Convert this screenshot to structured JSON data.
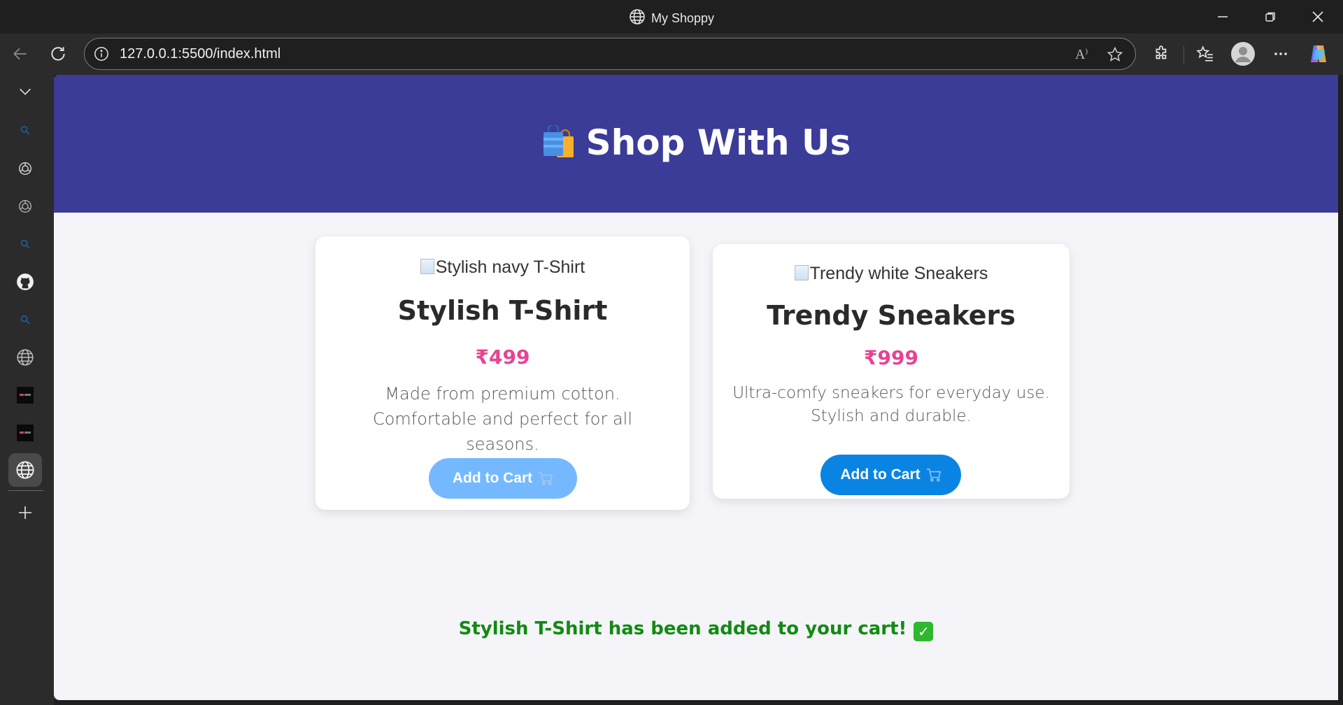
{
  "window": {
    "title": "My Shoppy",
    "minimize_icon": "minimize-icon",
    "restore_icon": "restore-icon",
    "close_icon": "close-icon"
  },
  "toolbar": {
    "url": "127.0.0.1:5500/index.html",
    "icons": [
      "back-icon",
      "refresh-icon",
      "info-icon",
      "read-aloud-icon",
      "favorite-star-icon",
      "extensions-icon",
      "favorites-icon",
      "profile-avatar",
      "more-icon",
      "copilot-icon"
    ]
  },
  "sidebar": {
    "items": [
      "collapse-icon",
      "search-icon",
      "chatgpt-icon",
      "chatgpt-icon",
      "search-icon",
      "github-icon",
      "search-icon",
      "globe-icon",
      "app-tile-icon",
      "app-tile-icon",
      "globe-icon",
      "add-icon"
    ]
  },
  "page": {
    "header": {
      "title": "Shop With Us",
      "icon": "shopping-bags-icon"
    },
    "products": [
      {
        "image_alt": "Stylish navy T-Shirt",
        "name": "Stylish T-Shirt",
        "price": "₹499",
        "description": "Made from premium cotton. Comfortable and perfect for all seasons.",
        "button_label": "Add to Cart",
        "button_icon": "cart-icon",
        "button_color": "#74b9ff"
      },
      {
        "image_alt": "Trendy white Sneakers",
        "name": "Trendy Sneakers",
        "price": "₹999",
        "description": "Ultra-comfy sneakers for everyday use. Stylish and durable.",
        "button_label": "Add to Cart",
        "button_icon": "cart-icon",
        "button_color": "#0984e3"
      }
    ],
    "confirmation": "Stylish T-Shirt has been added to your cart!",
    "confirmation_icon": "check-mark-icon"
  },
  "colors": {
    "header_bg": "#3b3b98",
    "price": "#e84393",
    "confirmation": "#128a12",
    "page_bg": "#f4f4f9"
  }
}
